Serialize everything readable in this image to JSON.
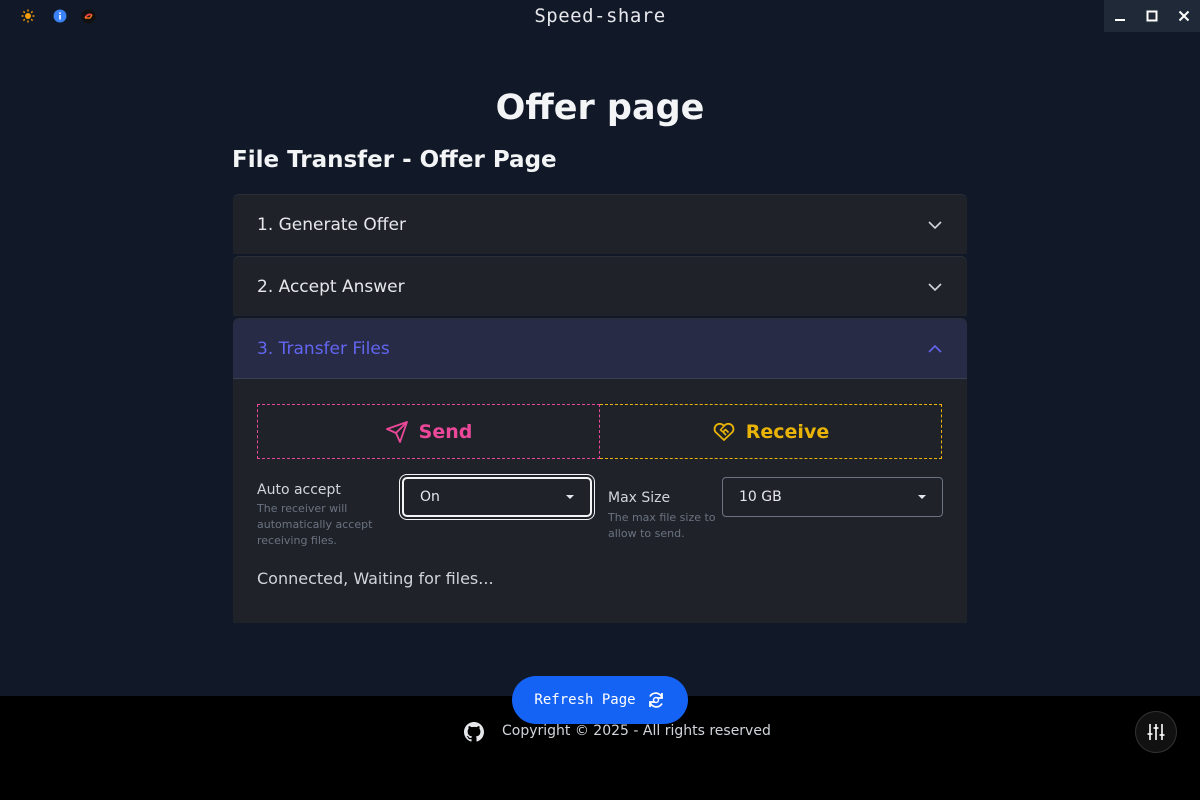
{
  "window": {
    "title": "Speed-share"
  },
  "page": {
    "title": "Offer page",
    "section_title": "File Transfer - Offer Page"
  },
  "accordion": {
    "items": [
      {
        "label": "1. Generate Offer"
      },
      {
        "label": "2. Accept Answer"
      },
      {
        "label": "3. Transfer Files"
      }
    ]
  },
  "transfer": {
    "send_label": "Send",
    "receive_label": "Receive",
    "auto_accept": {
      "label": "Auto accept",
      "description": "The receiver will automatically accept receiving files.",
      "value": "On"
    },
    "max_size": {
      "label": "Max Size",
      "description": "The max file size to allow to send.",
      "value": "10 GB"
    },
    "status": "Connected, Waiting for files..."
  },
  "footer": {
    "refresh_label": "Refresh Page",
    "copyright": "Copyright © 2025 - All rights reserved"
  },
  "colors": {
    "accent": "#6366f1",
    "send": "#ec4899",
    "receive": "#eab308",
    "refresh": "#1563f5"
  }
}
